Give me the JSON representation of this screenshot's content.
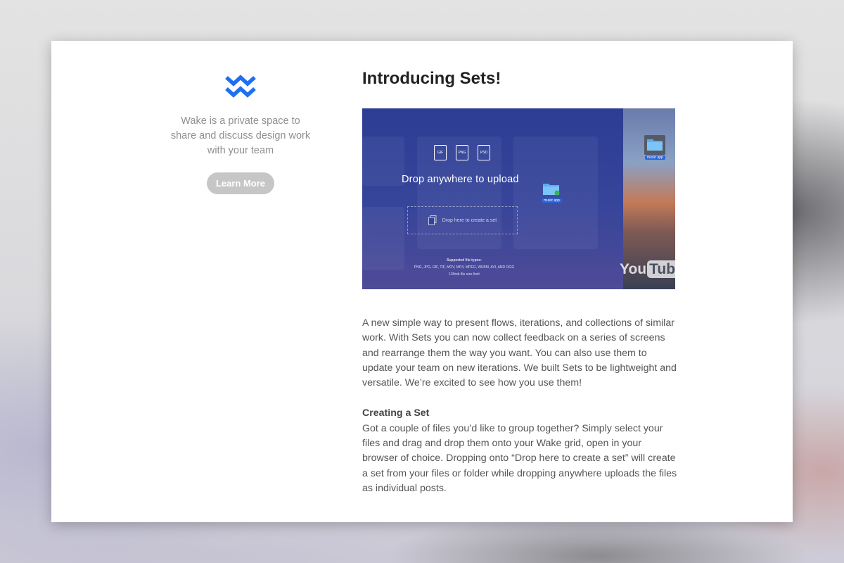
{
  "sidebar": {
    "logo_name": "wake-logo",
    "tagline": "Wake is a private space to share and discuss design work with your team",
    "learn_more_label": "Learn More"
  },
  "main": {
    "title": "Introducing Sets!",
    "video": {
      "file_types": [
        "GIF",
        "PNG",
        "PSD"
      ],
      "drop_anywhere_label": "Drop anywhere to upload",
      "drop_set_label": "Drop here to create a set",
      "folder_label": "music app",
      "supported_heading": "Supported file types:",
      "supported_list": "PNG, JPG, GIF, TIF, MOV, MP4, MPEG, WEBM, AVI, AND OGG",
      "size_limit": "100mb file size limit",
      "watermark_you": "You",
      "watermark_tube": "Tube"
    },
    "intro_paragraph": "A new simple way to present flows, iterations, and collections of similar work. With Sets you can now collect feedback on a series of screens and rearrange them the way you want. You can also use them to update your team on new iterations. We built Sets to be lightweight and versatile. We’re excited to see how you use them!",
    "creating_heading": "Creating a Set",
    "creating_paragraph": "Got a couple of files you’d like to group together? Simply select your files and drag and drop them onto your Wake grid, open in your browser of choice. Dropping onto “Drop here to create a set” will create a set from your files or folder while dropping anywhere uploads the files as individual posts."
  },
  "colors": {
    "brand_blue": "#1f6ff2",
    "button_gray": "#c6c6c6",
    "video_bg": "#2c3d93"
  }
}
